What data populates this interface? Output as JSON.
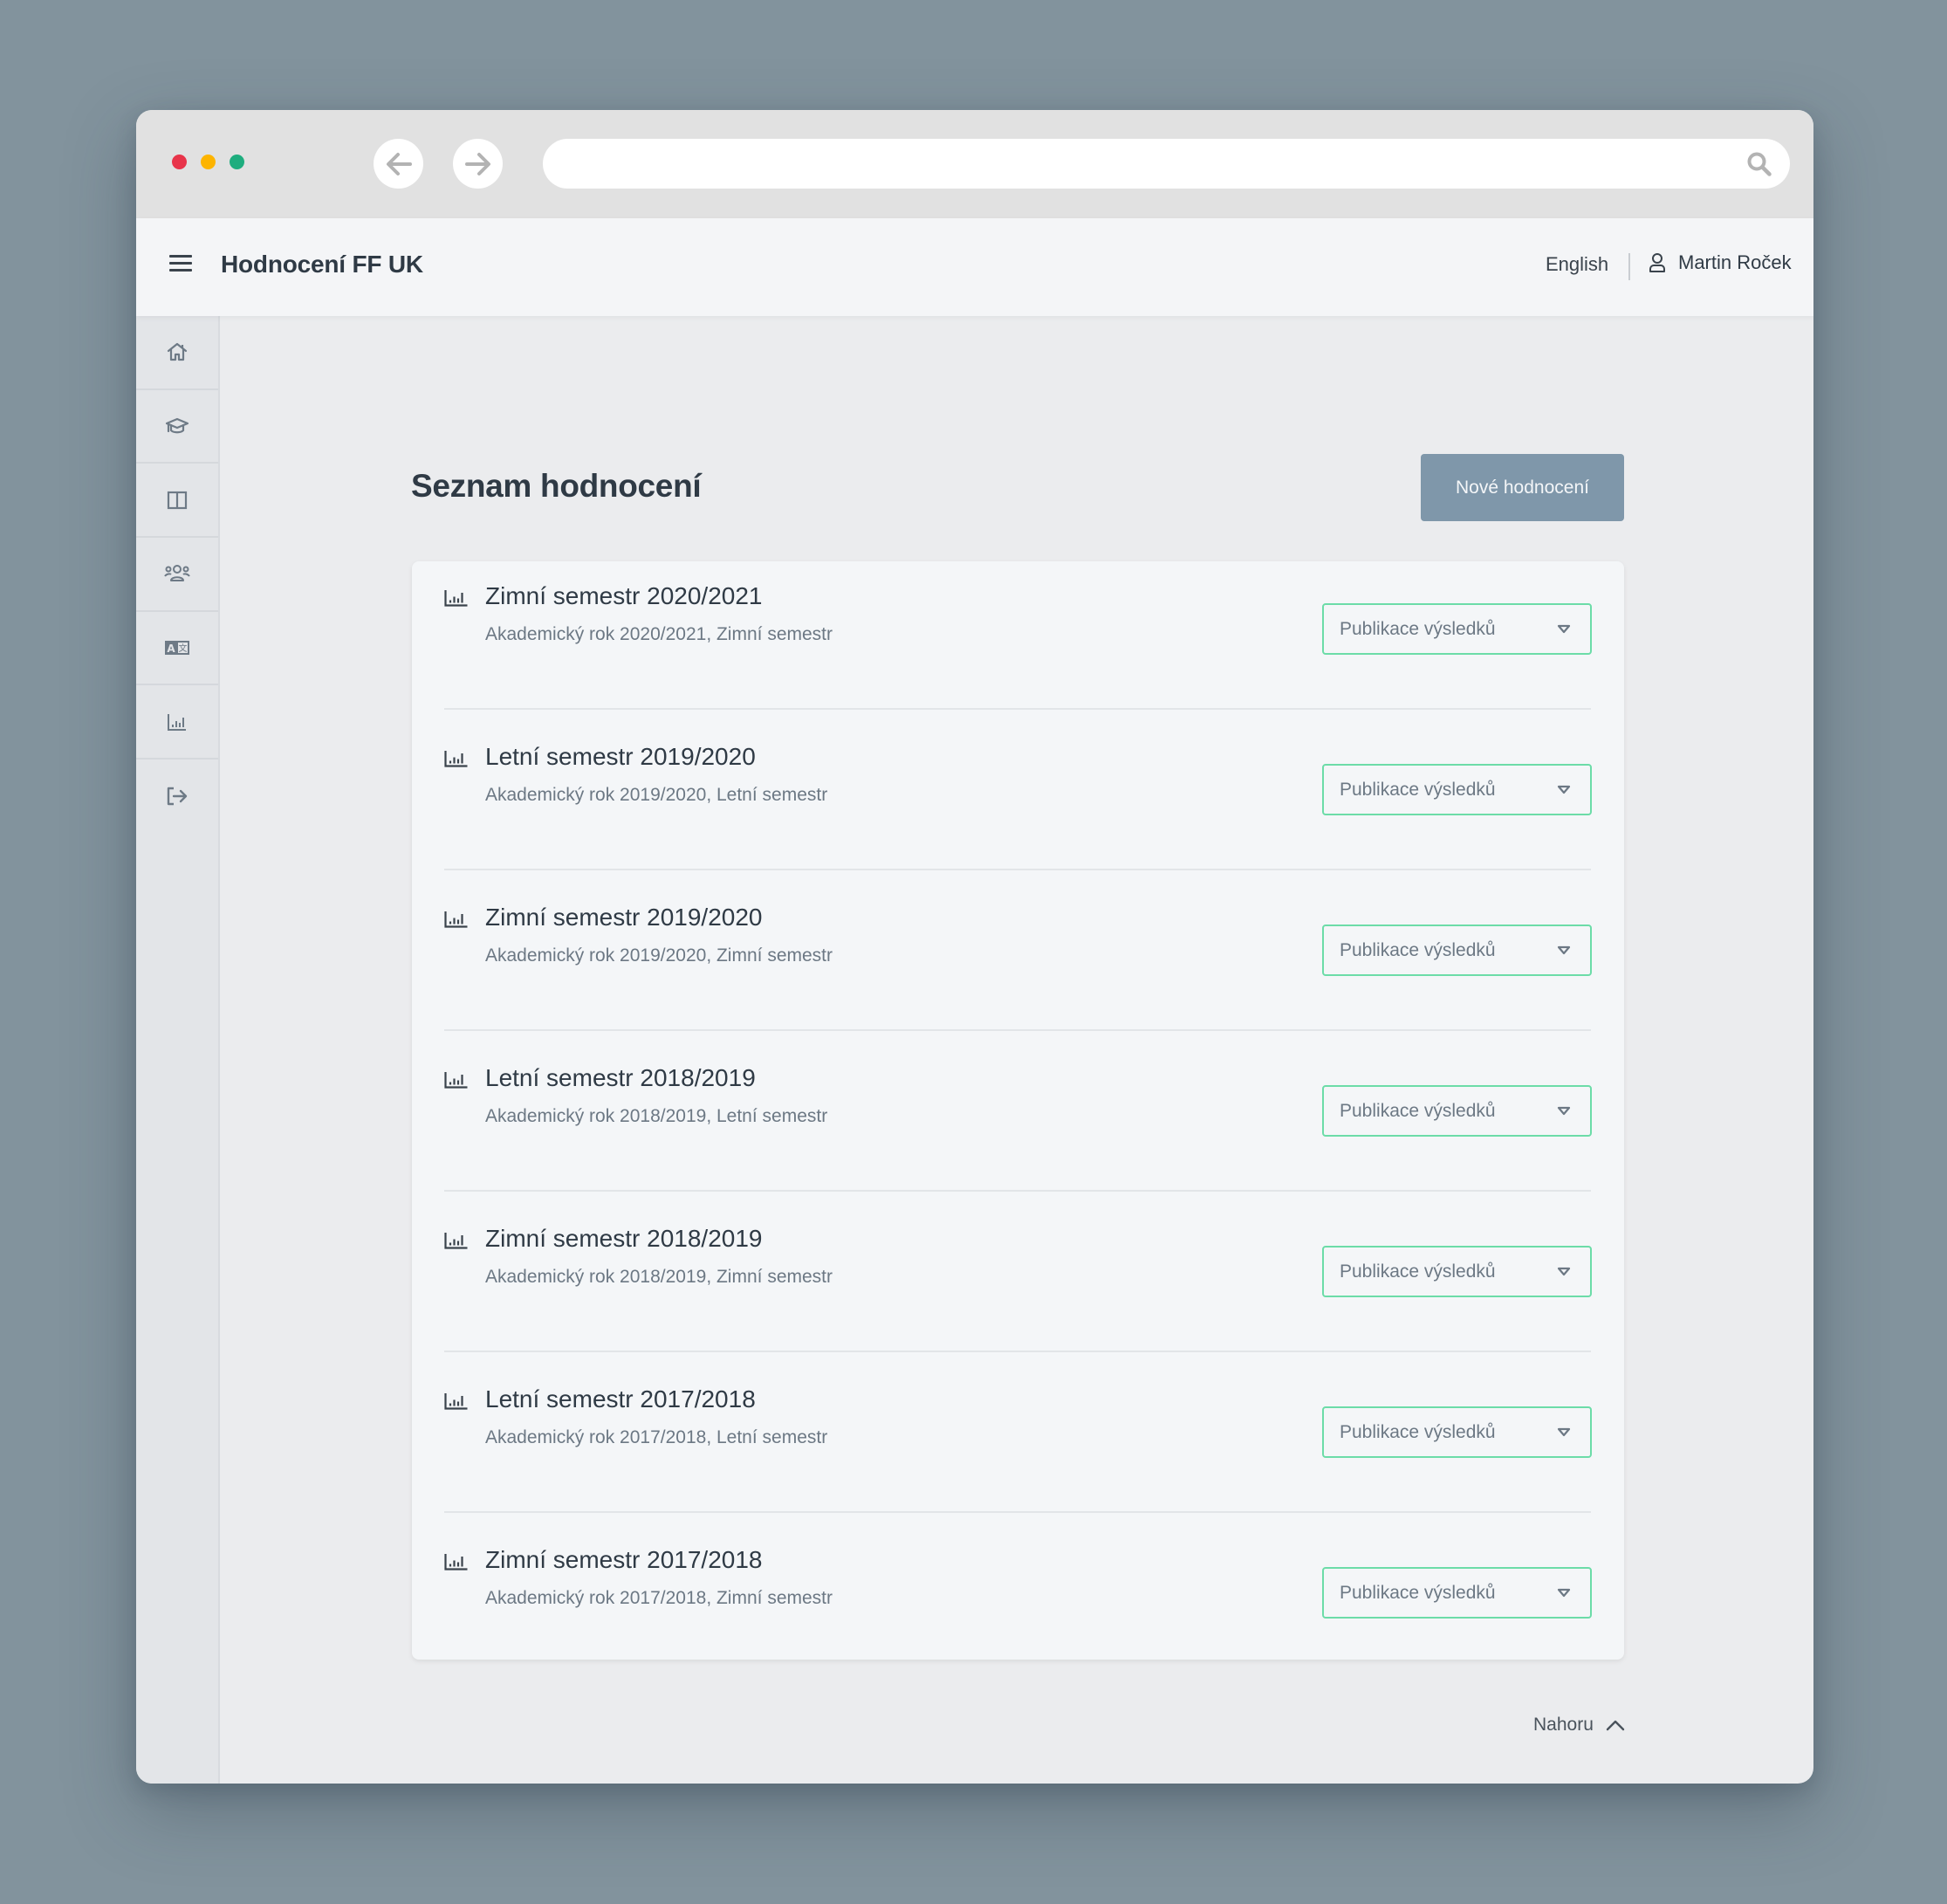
{
  "browser": {
    "url": "",
    "icons": {
      "back": "arrow-left-icon",
      "forward": "arrow-right-icon",
      "search": "search-icon"
    },
    "traffic_lights": {
      "close": "#e8344a",
      "minimize": "#fdb400",
      "maximize": "#1ead7e"
    }
  },
  "header": {
    "menu_icon": "hamburger-icon",
    "app_title": "Hodnocení FF UK",
    "language_link": "English",
    "user_icon": "user-icon",
    "user_name": "Martin Roček"
  },
  "sidebar": {
    "items": [
      {
        "icon": "home-icon"
      },
      {
        "icon": "graduation-cap-icon"
      },
      {
        "icon": "columns-icon"
      },
      {
        "icon": "users-icon"
      },
      {
        "icon": "translate-icon"
      },
      {
        "icon": "bar-chart-icon"
      },
      {
        "icon": "logout-icon"
      }
    ]
  },
  "main": {
    "title": "Seznam hodnocení",
    "new_button": "Nové hodnocení",
    "accent_color": "#6cdca8",
    "button_color": "#7f97aa",
    "evaluations": [
      {
        "title": "Zimní semestr 2020/2021",
        "subtitle": "Akademický rok 2020/2021, Zimní semestr",
        "status": "Publikace výsledků"
      },
      {
        "title": "Letní semestr 2019/2020",
        "subtitle": "Akademický rok 2019/2020, Letní semestr",
        "status": "Publikace výsledků"
      },
      {
        "title": "Zimní semestr 2019/2020",
        "subtitle": "Akademický rok 2019/2020, Zimní semestr",
        "status": "Publikace výsledků"
      },
      {
        "title": "Letní semestr 2018/2019",
        "subtitle": "Akademický rok 2018/2019, Letní semestr",
        "status": "Publikace výsledků"
      },
      {
        "title": "Zimní semestr 2018/2019",
        "subtitle": "Akademický rok 2018/2019, Zimní semestr",
        "status": "Publikace výsledků"
      },
      {
        "title": "Letní semestr 2017/2018",
        "subtitle": "Akademický rok 2017/2018, Letní semestr",
        "status": "Publikace výsledků"
      },
      {
        "title": "Zimní semestr 2017/2018",
        "subtitle": "Akademický rok 2017/2018, Zimní semestr",
        "status": "Publikace výsledků"
      }
    ],
    "back_to_top": "Nahoru"
  }
}
